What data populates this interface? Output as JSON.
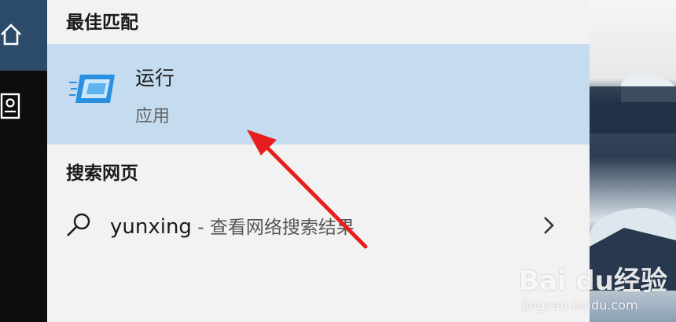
{
  "rail": {
    "home_icon": "home-icon",
    "document_icon": "document-icon"
  },
  "best_match": {
    "section_title": "最佳匹配",
    "app_name": "运行",
    "app_type": "应用",
    "icon": "run-app-icon"
  },
  "web_search": {
    "section_title": "搜索网页",
    "query": "yunxing",
    "separator": " - ",
    "description": "查看网络搜索结果",
    "icon": "search-icon",
    "chevron_icon": "chevron-right-icon"
  },
  "watermark": {
    "brand": "Bai du经验",
    "url": "jingyan.baidu.com"
  },
  "colors": {
    "highlight": "#c5dcf0",
    "rail_active": "#2c4a6a",
    "annotation_arrow": "#e81e1e"
  }
}
